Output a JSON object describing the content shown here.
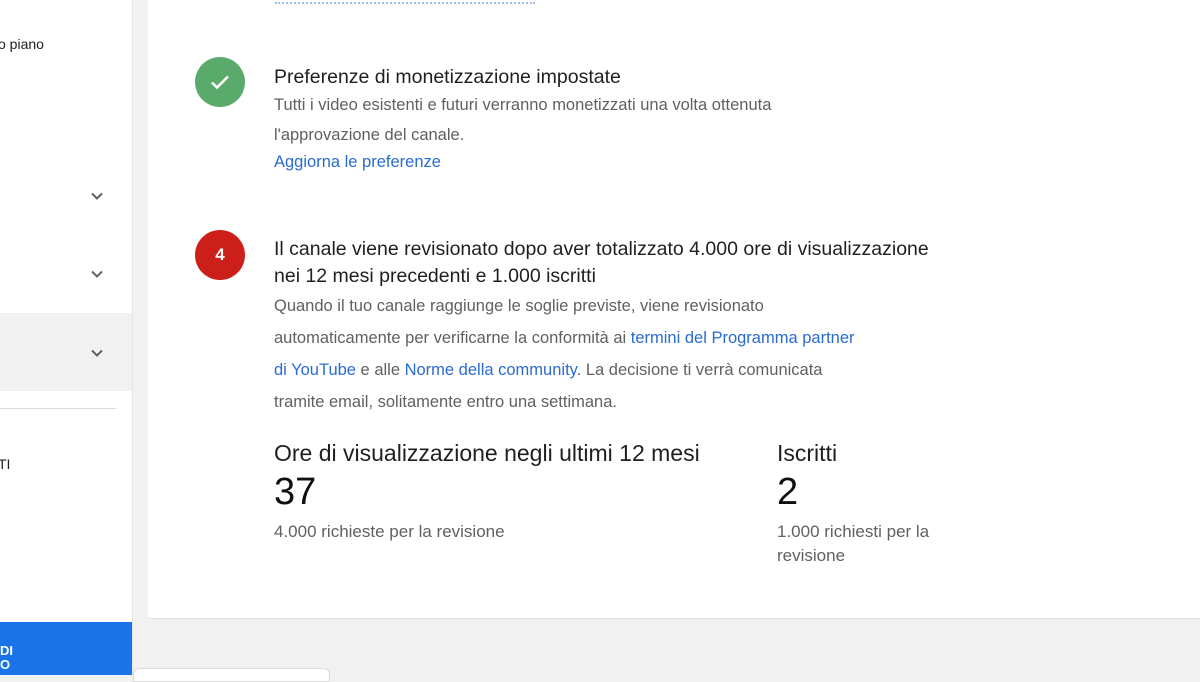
{
  "sidebar": {
    "item_plan": "o piano",
    "item_ti": "TI",
    "blue_button_line1": "DI",
    "blue_button_line2": "O"
  },
  "step_done": {
    "title": "Preferenze di monetizzazione impostate",
    "desc_line1": "Tutti i video esistenti e futuri verranno monetizzati una volta ottenuta",
    "desc_line2": "l'approvazione del canale.",
    "link": "Aggiorna le preferenze"
  },
  "step_review": {
    "number": "4",
    "title_line1": "Il canale viene revisionato dopo aver totalizzato 4.000 ore di visualizzazione",
    "title_line2": "nei 12 mesi precedenti e 1.000 iscritti",
    "desc_line1": "Quando il tuo canale raggiunge le soglie previste, viene revisionato",
    "desc_line2_pre": "automaticamente per verificarne la conformità ai ",
    "link_terms_a": "termini del Programma partner",
    "link_terms_b": "di YouTube",
    "desc_line3_mid": " e alle ",
    "link_community": "Norme della community",
    "desc_line3_post": ". La decisione ti verrà comunicata",
    "desc_line4": "tramite email, solitamente entro una settimana."
  },
  "stats": {
    "hours": {
      "label": "Ore di visualizzazione negli ultimi 12 mesi",
      "value": "37",
      "sub": "4.000 richieste per la revisione"
    },
    "subscribers": {
      "label": "Iscritti",
      "value": "2",
      "sub_line1": "1.000 richiesti per la",
      "sub_line2": "revisione"
    }
  },
  "colors": {
    "done": "#5aaa6b",
    "pending": "#cc1f1a",
    "link": "#2a6bd0",
    "sidebar_button": "#1a73e8"
  }
}
